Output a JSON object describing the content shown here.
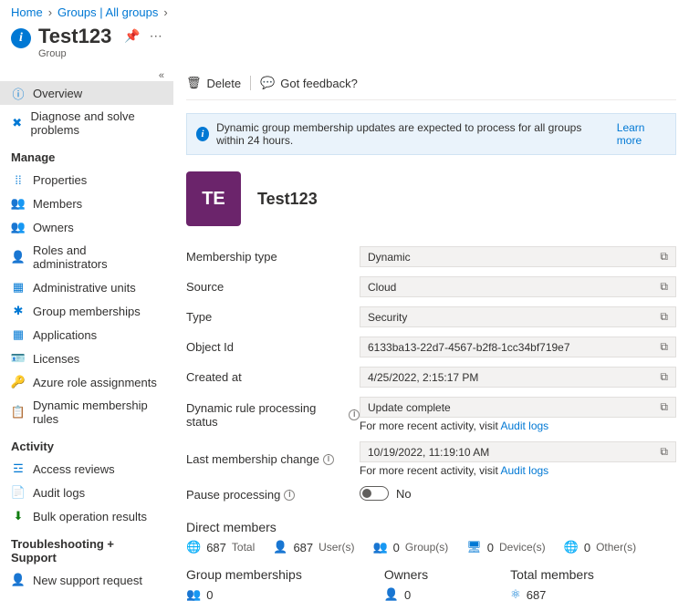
{
  "breadcrumb": {
    "home": "Home",
    "groups": "Groups | All groups"
  },
  "header": {
    "title": "Test123",
    "subtitle": "Group"
  },
  "toolbar": {
    "delete": "Delete",
    "feedback": "Got feedback?"
  },
  "info_banner": {
    "text": "Dynamic group membership updates are expected to process for all groups within 24 hours.",
    "learn_more": "Learn more"
  },
  "group": {
    "initials": "TE",
    "name": "Test123"
  },
  "sidebar": {
    "overview": "Overview",
    "diagnose": "Diagnose and solve problems",
    "manage_head": "Manage",
    "properties": "Properties",
    "members": "Members",
    "owners": "Owners",
    "roles": "Roles and administrators",
    "admin_units": "Administrative units",
    "group_memberships": "Group memberships",
    "applications": "Applications",
    "licenses": "Licenses",
    "azure_roles": "Azure role assignments",
    "dynamic_rules": "Dynamic membership rules",
    "activity_head": "Activity",
    "access_reviews": "Access reviews",
    "audit_logs": "Audit logs",
    "bulk_results": "Bulk operation results",
    "trouble_head": "Troubleshooting + Support",
    "new_support": "New support request"
  },
  "props": {
    "membership_type": {
      "label": "Membership type",
      "value": "Dynamic"
    },
    "source": {
      "label": "Source",
      "value": "Cloud"
    },
    "type": {
      "label": "Type",
      "value": "Security"
    },
    "object_id": {
      "label": "Object Id",
      "value": "6133ba13-22d7-4567-b2f8-1cc34bf719e7"
    },
    "created_at": {
      "label": "Created at",
      "value": "4/25/2022, 2:15:17 PM"
    },
    "dyn_status": {
      "label": "Dynamic rule processing status",
      "value": "Update complete",
      "note_prefix": "For more recent activity, visit ",
      "note_link": "Audit logs"
    },
    "last_change": {
      "label": "Last membership change",
      "value": "10/19/2022, 11:19:10 AM",
      "note_prefix": "For more recent activity, visit ",
      "note_link": "Audit logs"
    },
    "pause": {
      "label": "Pause processing",
      "value": "No"
    }
  },
  "direct_members": {
    "title": "Direct members",
    "total": {
      "value": "687",
      "label": "Total"
    },
    "users": {
      "value": "687",
      "label": "User(s)"
    },
    "groups": {
      "value": "0",
      "label": "Group(s)"
    },
    "devices": {
      "value": "0",
      "label": "Device(s)"
    },
    "others": {
      "value": "0",
      "label": "Other(s)"
    }
  },
  "bottom": {
    "group_memberships": {
      "title": "Group memberships",
      "value": "0"
    },
    "owners": {
      "title": "Owners",
      "value": "0"
    },
    "total_members": {
      "title": "Total members",
      "value": "687"
    }
  }
}
